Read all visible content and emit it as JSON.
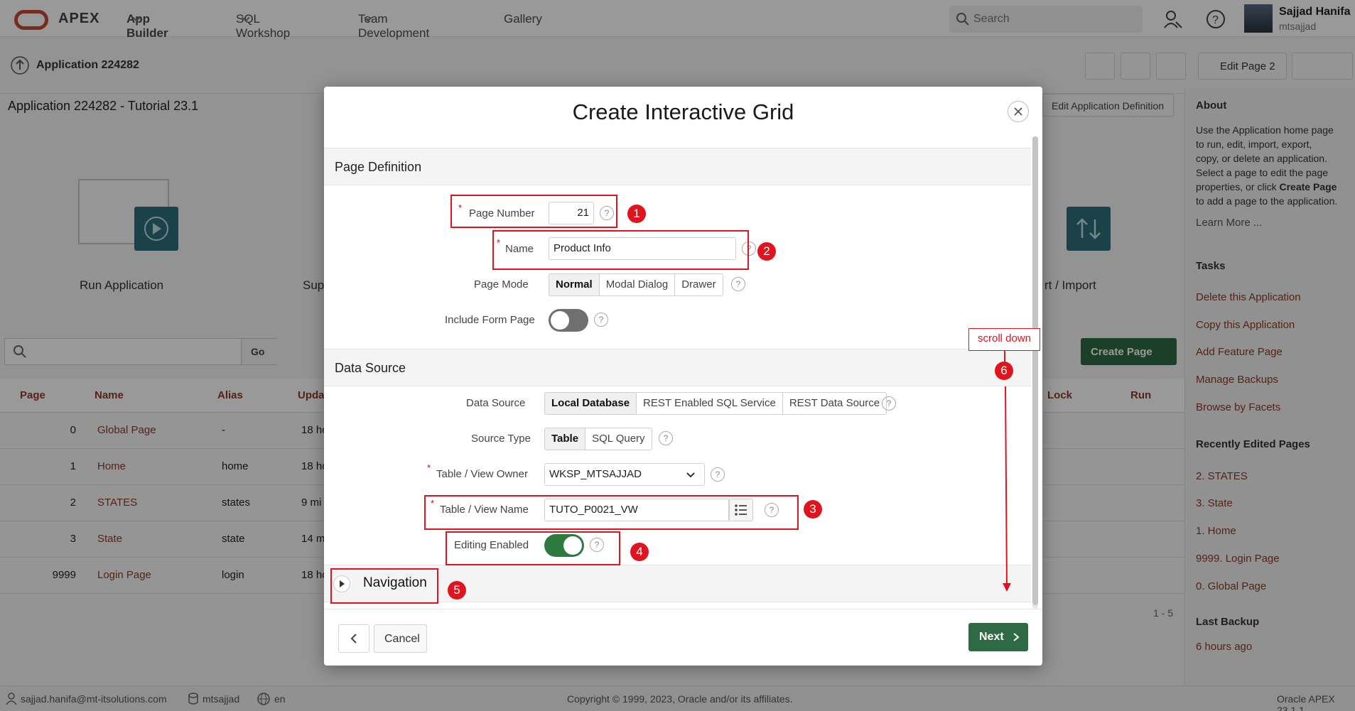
{
  "topbar": {
    "brand": "APEX",
    "nav": [
      "App Builder",
      "SQL Workshop",
      "Team Development",
      "Gallery"
    ],
    "search_placeholder": "Search",
    "user_name": "Sajjad Hanifa",
    "user_id": "mtsajjad"
  },
  "breadcrumb": {
    "label": "Application 224282",
    "edit_page": "Edit Page 2"
  },
  "page": {
    "title": "Application 224282 - Tutorial 23.1",
    "edit_app_def": "Edit Application Definition",
    "tiles": [
      "Run Application",
      "Sup",
      "rt / Import"
    ],
    "go": "Go",
    "create_page": "Create Page",
    "columns": [
      "Page",
      "Name",
      "Alias",
      "Upda",
      "Lock",
      "Run"
    ],
    "rows": [
      {
        "page": "0",
        "name": "Global Page",
        "alias": "-",
        "updated": "18 ho"
      },
      {
        "page": "1",
        "name": "Home",
        "alias": "home",
        "updated": "18 ho"
      },
      {
        "page": "2",
        "name": "STATES",
        "alias": "states",
        "updated": "9 mi"
      },
      {
        "page": "3",
        "name": "State",
        "alias": "state",
        "updated": "14 m"
      },
      {
        "page": "9999",
        "name": "Login Page",
        "alias": "login",
        "updated": "18 ho"
      }
    ],
    "range": "1 - 5"
  },
  "sidebar": {
    "about_title": "About",
    "about_text_1": "Use the Application home page",
    "about_text_2": "to run, edit, import, export,",
    "about_text_3": "copy, or delete an application.",
    "about_text_4": "Select a page to edit the page",
    "about_text_5": "properties, or click",
    "about_text_5b": "Create Page",
    "about_text_6": "to add a page to the application.",
    "learn_more": "Learn More ...",
    "tasks_title": "Tasks",
    "tasks": [
      "Delete this Application",
      "Copy this Application",
      "Add Feature Page",
      "Manage Backups",
      "Browse by Facets"
    ],
    "recent_title": "Recently Edited Pages",
    "recent": [
      "2. STATES",
      "3. State",
      "1. Home",
      "9999. Login Page",
      "0. Global Page"
    ],
    "backup_title": "Last Backup",
    "backup_value": "6 hours ago"
  },
  "modal": {
    "title": "Create Interactive Grid",
    "page_def_title": "Page Definition",
    "page_number_label": "Page Number",
    "page_number_value": "21",
    "name_label": "Name",
    "name_value": "Product Info",
    "page_mode_label": "Page Mode",
    "page_modes": [
      "Normal",
      "Modal Dialog",
      "Drawer"
    ],
    "include_form_label": "Include Form Page",
    "data_source_title": "Data Source",
    "data_source_label": "Data Source",
    "data_sources": [
      "Local Database",
      "REST Enabled SQL Service",
      "REST Data Source"
    ],
    "source_type_label": "Source Type",
    "source_types": [
      "Table",
      "SQL Query"
    ],
    "owner_label": "Table / View Owner",
    "owner_value": "WKSP_MTSAJJAD",
    "view_name_label": "Table / View Name",
    "view_name_value": "TUTO_P0021_VW",
    "editing_label": "Editing Enabled",
    "navigation_title": "Navigation",
    "cancel": "Cancel",
    "next": "Next",
    "include_form_enabled": false,
    "editing_enabled": true
  },
  "annotations": {
    "numbers": [
      "1",
      "2",
      "3",
      "4",
      "5",
      "6"
    ],
    "scroll_label": "scroll down",
    "color": "#e0141e"
  },
  "footer": {
    "email": "sajjad.hanifa@mt-itsolutions.com",
    "workspace": "mtsajjad",
    "lang": "en",
    "copyright": "Copyright © 1999, 2023, Oracle and/or its affiliates.",
    "version": "Oracle APEX 23.1.1"
  },
  "colors": {
    "accent": "#2e6b45",
    "brand": "#c74634",
    "link": "#8a3a2a"
  }
}
